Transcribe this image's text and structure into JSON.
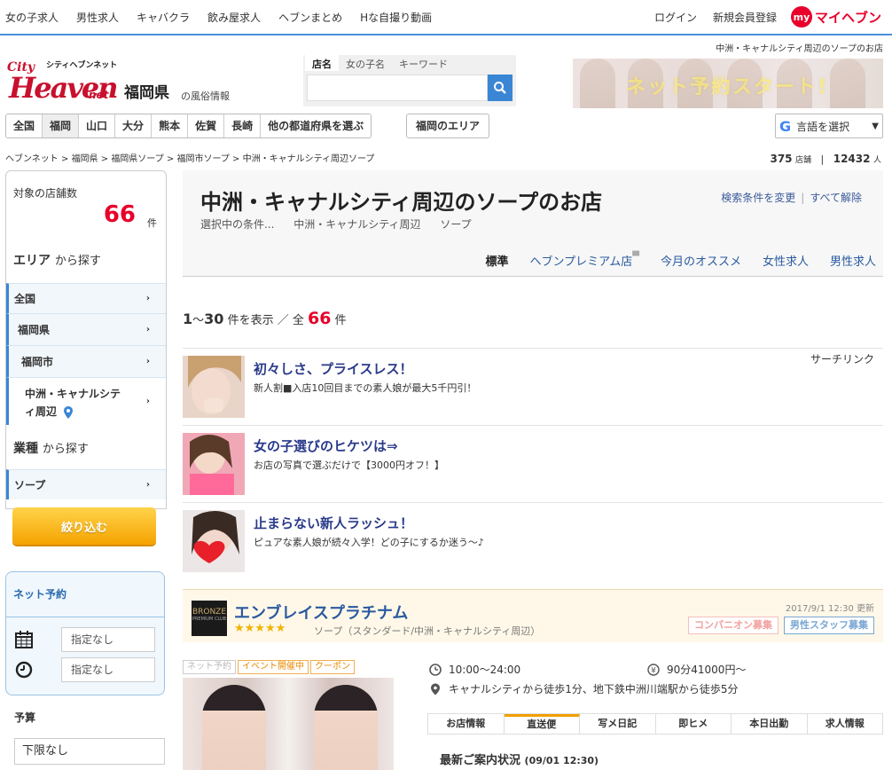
{
  "topbar": {
    "links": [
      "女の子求人",
      "男性求人",
      "キャバクラ",
      "飲み屋求人",
      "ヘブンまとめ",
      "Hな自撮り動画"
    ],
    "login": "ログイン",
    "register": "新規会員登録",
    "my_badge": "my",
    "my_label": "マイヘブン"
  },
  "header": {
    "logo_sub": "シティヘブンネット",
    "logo_city": "City",
    "logo_heaven": "Heaven",
    "logo_net": "net",
    "prefecture": "福岡県",
    "prefecture_sub": "の風俗情報",
    "note": "中洲・キャナルシティ周辺のソープのお店",
    "banner_text": "ネット予約スタート!",
    "search": {
      "tabs": [
        "店名",
        "女の子名",
        "キーワード"
      ],
      "active_tab": 0,
      "value": ""
    }
  },
  "nav": {
    "prefs": [
      "全国",
      "福岡",
      "山口",
      "大分",
      "熊本",
      "佐賀",
      "長崎",
      "他の都道府県を選ぶ"
    ],
    "current": 1,
    "area": "福岡のエリア",
    "lang": "言語を選択",
    "lang_g": "G"
  },
  "breadcrumb": [
    "ヘブンネット",
    "福岡県",
    "福岡県ソープ",
    "福岡市ソープ",
    "中洲・キャナルシティ周辺ソープ"
  ],
  "counts": {
    "shops": "375",
    "shops_unit": "店舗",
    "girls": "12432",
    "girls_unit": "人"
  },
  "sidebar": {
    "count_label": "対象の店舗数",
    "count": "66",
    "count_unit": "件",
    "area_heading": "エリア",
    "area_suffix": "から探す",
    "areas": [
      "全国",
      "福岡県",
      "福岡市",
      "中洲・キャナルシティ周辺"
    ],
    "kind_heading": "業種",
    "kind_suffix": "から探す",
    "kinds": [
      "ソープ"
    ],
    "narrow_button": "絞り込む",
    "reserve_heading": "ネット予約",
    "date_placeholder": "指定なし",
    "time_placeholder": "指定なし",
    "budget_heading": "予算",
    "budget_min": "下限なし"
  },
  "main": {
    "title": "中洲・キャナルシティ周辺のソープのお店",
    "conds_label": "選択中の条件...",
    "conds": [
      "中洲・キャナルシティ周辺",
      "ソープ"
    ],
    "change": "検索条件を変更",
    "clear": "すべて解除",
    "sort_tabs": [
      "標準",
      "ヘブンプレミアム店",
      "今月のオススメ",
      "女性求人",
      "男性求人"
    ],
    "range_start": "1",
    "range_end": "30",
    "range_text": "件を表示 ／ 全",
    "total": "66",
    "total_unit": "件",
    "search_link": "サーチリンク",
    "ads": [
      {
        "title": "初々しさ、プライスレス！",
        "desc": "新人割■入店10回目までの素人娘が最大5千円引！"
      },
      {
        "title": "女の子選びのヒケツは⇒",
        "desc": "お店の写真で選ぶだけで【3000円オフ！】"
      },
      {
        "title": "止まらない新人ラッシュ！",
        "desc": "ピュアな素人娘が続々入学！どの子にするか迷う～♪"
      }
    ],
    "shop": {
      "badge": "BRONZE",
      "badge_sub": "PREMIUM CLUB",
      "name": "エンブレイスプラチナム",
      "stars": "★★★★★",
      "category": "ソープ（スタンダード/中洲・キャナルシティ周辺）",
      "updated": "2017/9/1 12:30 更新",
      "recruit_female": "コンパニオン募集",
      "recruit_male": "男性スタッフ募集",
      "tags": [
        "ネット予約",
        "イベント開催中",
        "クーポン"
      ],
      "hours": "10:00～24:00",
      "price": "90分41000円～",
      "access": "キャナルシティから徒歩1分、地下鉄中洲川端駅から徒歩5分",
      "tabs": [
        "お店情報",
        "直送便",
        "写メ日記",
        "即ヒメ",
        "本日出勤",
        "求人情報"
      ],
      "active_tab": 1,
      "news": "最新ご案内状況",
      "news_time": "(09/01 12:30)"
    }
  }
}
